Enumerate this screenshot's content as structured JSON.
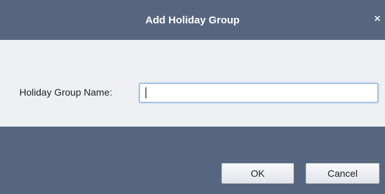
{
  "dialog": {
    "title": "Add Holiday Group",
    "close_glyph": "×",
    "close_icon": "close-icon"
  },
  "form": {
    "holiday_group_name_label": "Holiday Group Name:",
    "holiday_group_name_value": "",
    "holiday_group_name_placeholder": ""
  },
  "buttons": {
    "ok_label": "OK",
    "cancel_label": "Cancel"
  },
  "colors": {
    "header_bg": "#56667f",
    "footer_bg": "#56667f",
    "body_bg": "#eef0f4",
    "input_focus_border": "#8fb0d6"
  }
}
